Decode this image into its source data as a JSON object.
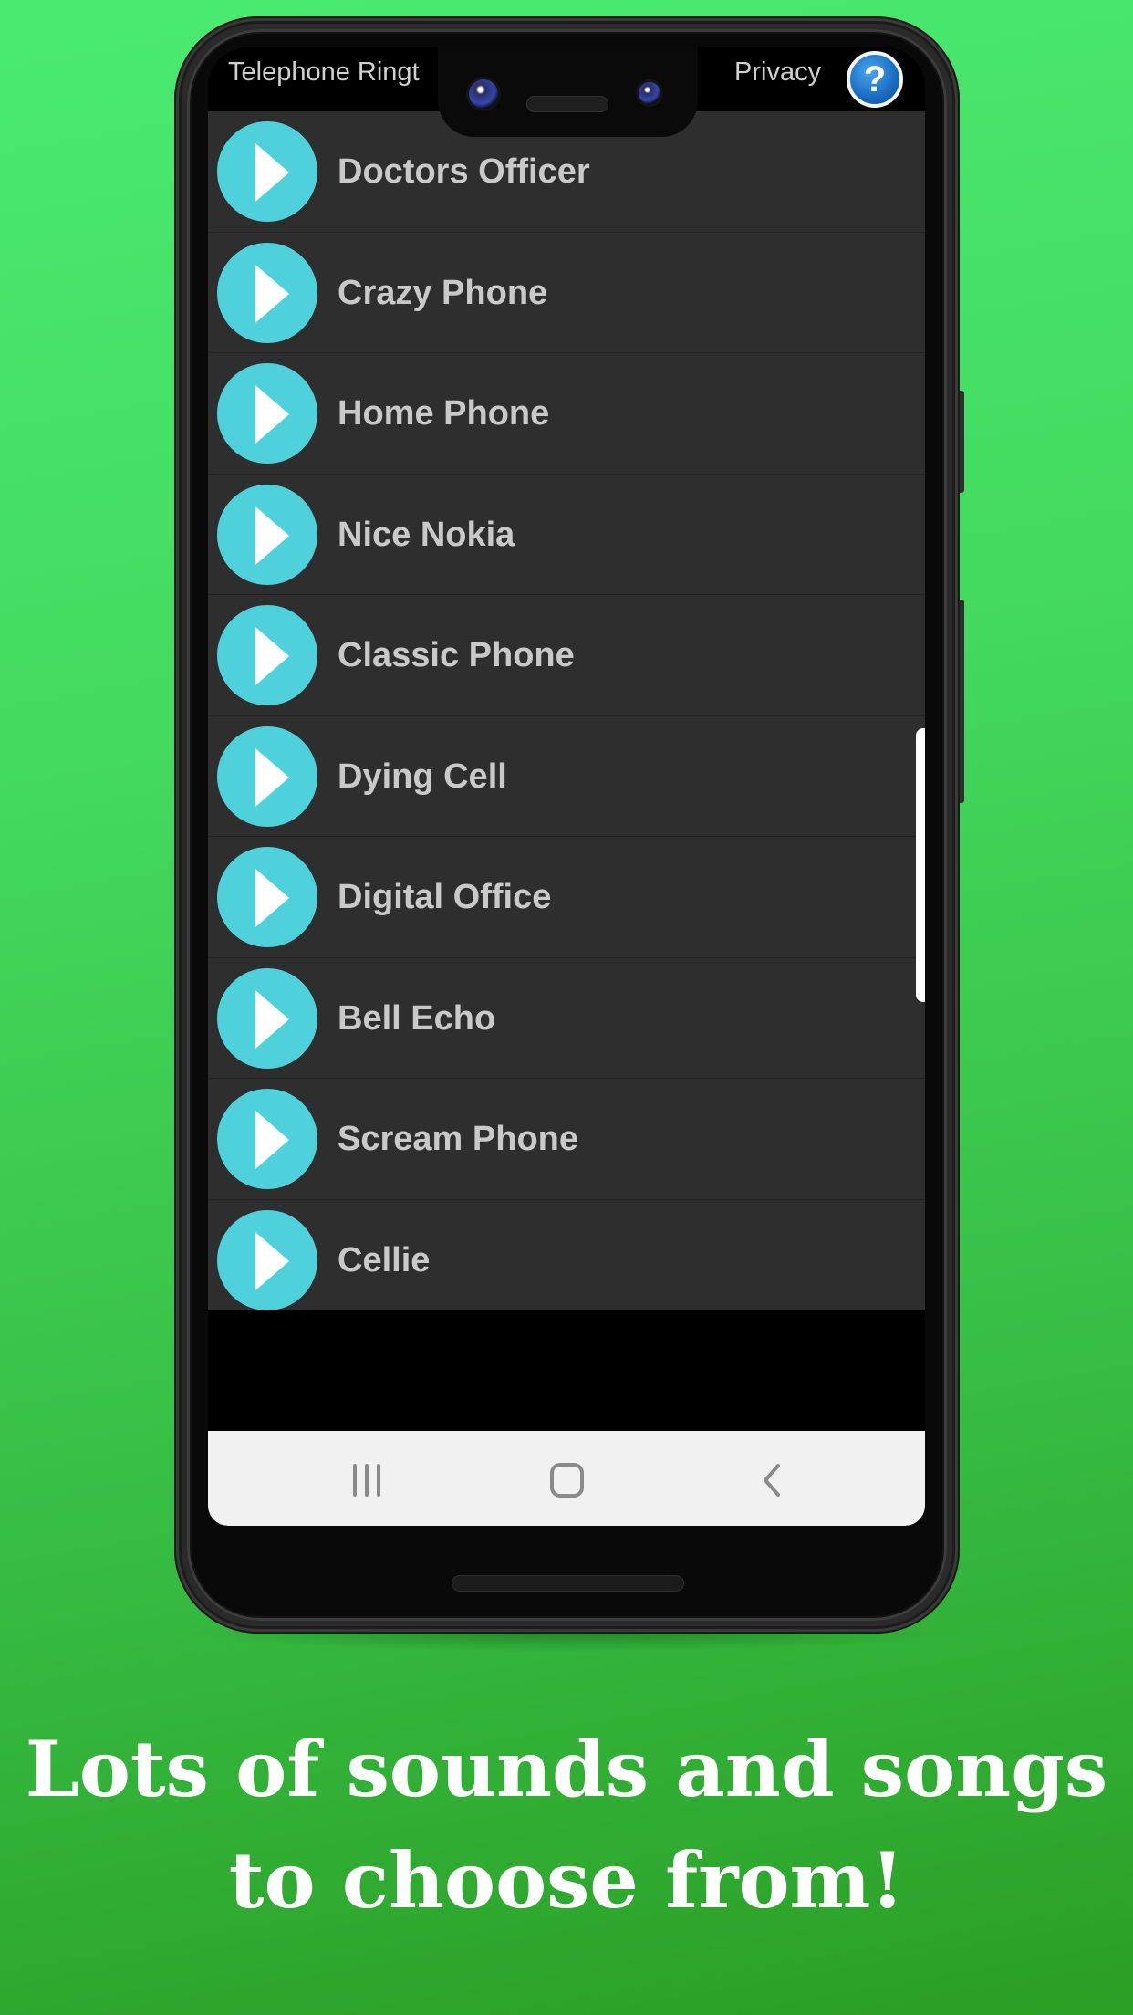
{
  "app": {
    "title": "Telephone Ringt",
    "privacy_label": "Privacy",
    "help_icon": "question-mark-icon"
  },
  "ringtones": [
    {
      "label": "Doctors Officer"
    },
    {
      "label": "Crazy Phone"
    },
    {
      "label": "Home Phone"
    },
    {
      "label": "Nice Nokia"
    },
    {
      "label": "Classic Phone"
    },
    {
      "label": "Dying Cell"
    },
    {
      "label": "Digital Office"
    },
    {
      "label": "Bell Echo"
    },
    {
      "label": "Scream Phone"
    },
    {
      "label": "Cellie"
    }
  ],
  "navbar": {
    "recents_icon": "recent-apps-icon",
    "home_icon": "home-icon",
    "back_icon": "back-chevron-icon"
  },
  "caption": {
    "line1": "Lots of sounds and songs",
    "line2": "to choose from!"
  },
  "colors": {
    "accent_play": "#4fd1db",
    "list_bg": "#2e2e2e",
    "label_text": "#c9c9c9"
  }
}
